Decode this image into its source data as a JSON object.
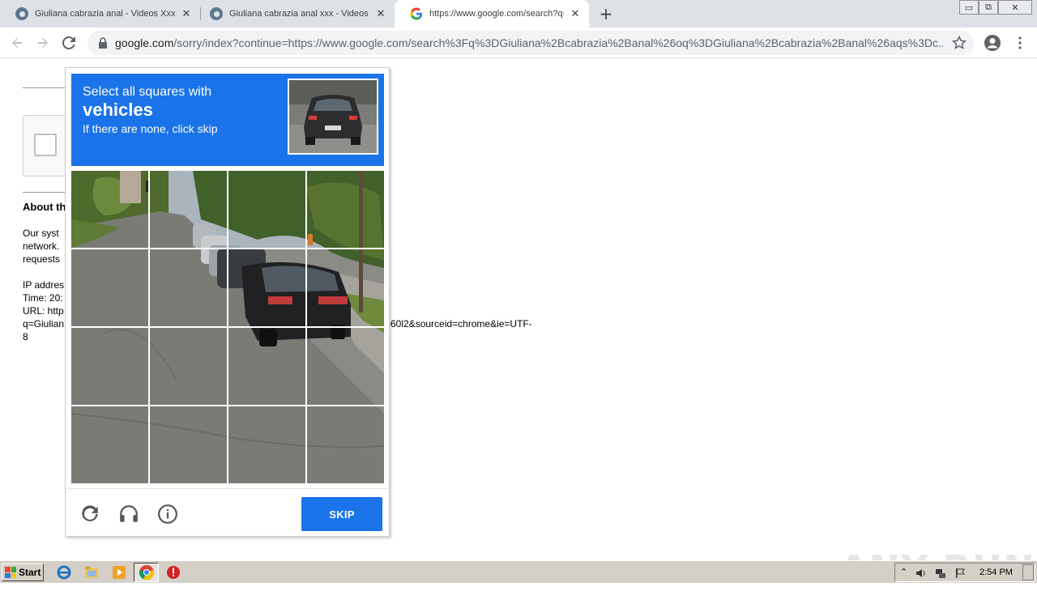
{
  "browser": {
    "tabs": [
      {
        "title": "Giuliana cabrazia anal - Videos Xxx Por",
        "active": false
      },
      {
        "title": "Giuliana cabrazia anal xxx - Videos XXX",
        "active": false
      },
      {
        "title": "https://www.google.com/search?q=",
        "active": true
      }
    ],
    "url_domain": "google.com",
    "url_path": "/sorry/index?continue=https://www.google.com/search%3Fq%3DGiuliana%2Bcabrazia%2Banal%26oq%3DGiuliana%2Bcabrazia%2Banal%26aqs%3Dc..."
  },
  "page": {
    "about_heading": "About th",
    "para_lines": [
      "Our syst",
      "network.",
      "requests"
    ],
    "ip_line": "IP addres",
    "time_line": "Time: 20:",
    "url_line": "URL: http",
    "q_line": "q=Giulian",
    "url_tail": ")60l2&sourceid=chrome&ie=UTF-",
    "url_tail2": "8"
  },
  "captcha": {
    "instruction_line1": "Select all squares with",
    "target_object": "vehicles",
    "instruction_line3": "If there are none, click skip",
    "skip_label": "SKIP",
    "grid_rows": 4,
    "grid_cols": 4,
    "accent_color": "#1a73e8"
  },
  "icons": {
    "reload": "reload-icon",
    "audio": "headphones-icon",
    "info": "info-icon"
  },
  "watermark": "ANY RUN",
  "taskbar": {
    "start_label": "Start",
    "clock": "2:54 PM"
  }
}
